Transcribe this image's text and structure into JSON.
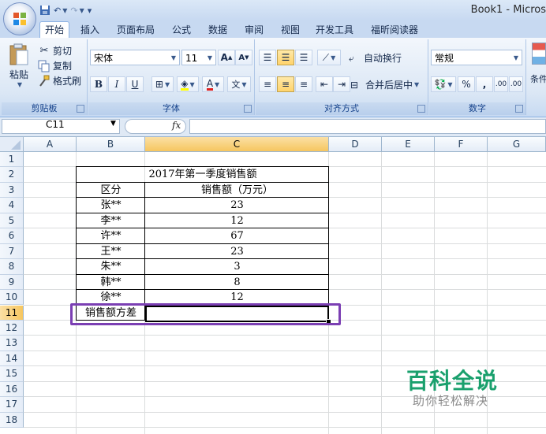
{
  "window": {
    "title": "Book1 - Micros"
  },
  "tabs": [
    "开始",
    "插入",
    "页面布局",
    "公式",
    "数据",
    "审阅",
    "视图",
    "开发工具",
    "福昕阅读器"
  ],
  "ribbon": {
    "clipboard": {
      "paste": "粘贴",
      "cut": "剪切",
      "copy": "复制",
      "format_painter": "格式刷",
      "label": "剪贴板"
    },
    "font": {
      "name": "宋体",
      "size": "11",
      "bold": "B",
      "italic": "I",
      "underline": "U",
      "grow": "A",
      "shrink": "A",
      "label": "字体"
    },
    "alignment": {
      "wrap_text": "自动换行",
      "merge_center": "合并后居中",
      "label": "对齐方式"
    },
    "number": {
      "format": "常规",
      "percent": "%",
      "comma": ",",
      "inc_decimal": ".00",
      "dec_decimal": ".00",
      "label": "数字"
    },
    "styles": {
      "conditional": "条件"
    }
  },
  "formula_bar": {
    "name_box": "C11",
    "fx": "fx",
    "content": ""
  },
  "grid": {
    "columns": [
      "A",
      "B",
      "C",
      "D",
      "E",
      "F",
      "G"
    ],
    "rows": [
      "1",
      "2",
      "3",
      "4",
      "5",
      "6",
      "7",
      "8",
      "9",
      "10",
      "11",
      "12",
      "13",
      "14",
      "15",
      "16",
      "17",
      "18"
    ],
    "selected_col": "C",
    "selected_row": "11"
  },
  "table": {
    "title": "2017年第一季度销售额",
    "headers": [
      "区分",
      "销售额（万元）"
    ],
    "rows": [
      [
        "张**",
        "23"
      ],
      [
        "李**",
        "12"
      ],
      [
        "许**",
        "67"
      ],
      [
        "王**",
        "23"
      ],
      [
        "朱**",
        "3"
      ],
      [
        "韩**",
        "8"
      ],
      [
        "徐**",
        "12"
      ]
    ],
    "variance_label": "销售额方差",
    "variance_value": ""
  },
  "watermark": {
    "title": "百科全说",
    "subtitle": "助你轻松解决"
  },
  "colors": {
    "highlight_box": "#7b3fb3",
    "watermark": "#1aa06d",
    "selected_header": "#f6c65f"
  }
}
